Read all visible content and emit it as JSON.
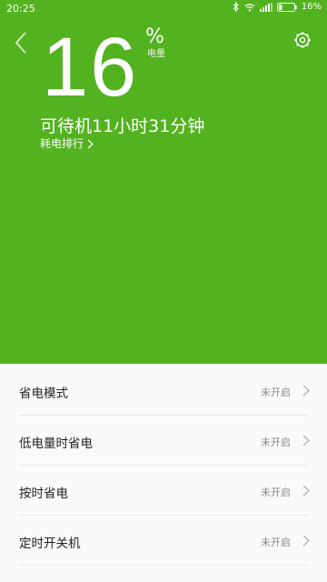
{
  "status_bar": {
    "time": "20:25",
    "battery_text": "16%"
  },
  "battery": {
    "percent": "16",
    "percent_sign": "%",
    "unit_label": "电量",
    "standby_text": "可待机11小时31分钟",
    "rank_label": "耗电排行"
  },
  "colors": {
    "hero_bg": "#52b21f",
    "list_bg": "#fafafa"
  },
  "settings_list": [
    {
      "label": "省电模式",
      "status": "未开启"
    },
    {
      "label": "低电量时省电",
      "status": "未开启"
    },
    {
      "label": "按时省电",
      "status": "未开启"
    },
    {
      "label": "定时开关机",
      "status": "未开启"
    }
  ],
  "icons": {
    "back": "chevron-left-icon",
    "settings": "gear-icon",
    "bluetooth": "bluetooth-icon",
    "wifi": "wifi-icon",
    "signal": "signal-icon",
    "battery": "battery-icon"
  }
}
